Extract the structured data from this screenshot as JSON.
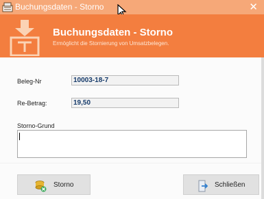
{
  "window": {
    "title": "Buchungsdaten - Storno",
    "close_glyph": "✕"
  },
  "header": {
    "title": "Buchungsdaten - Storno",
    "subtitle": "Ermöglicht die Stornierung von Umsatzbelegen.",
    "icon": "cancel-document-icon"
  },
  "form": {
    "beleg_label": "Beleg-Nr",
    "beleg_value": "10003-18-7",
    "betrag_label": "Re-Betrag:",
    "betrag_value": "19,50",
    "grund_label": "Storno-Grund",
    "grund_value": ""
  },
  "buttons": {
    "storno_label": "Storno",
    "schliessen_label": "Schließen"
  },
  "colors": {
    "titlebar": "#f6a878",
    "header": "#f37e3f",
    "field_text": "#153a6a"
  }
}
